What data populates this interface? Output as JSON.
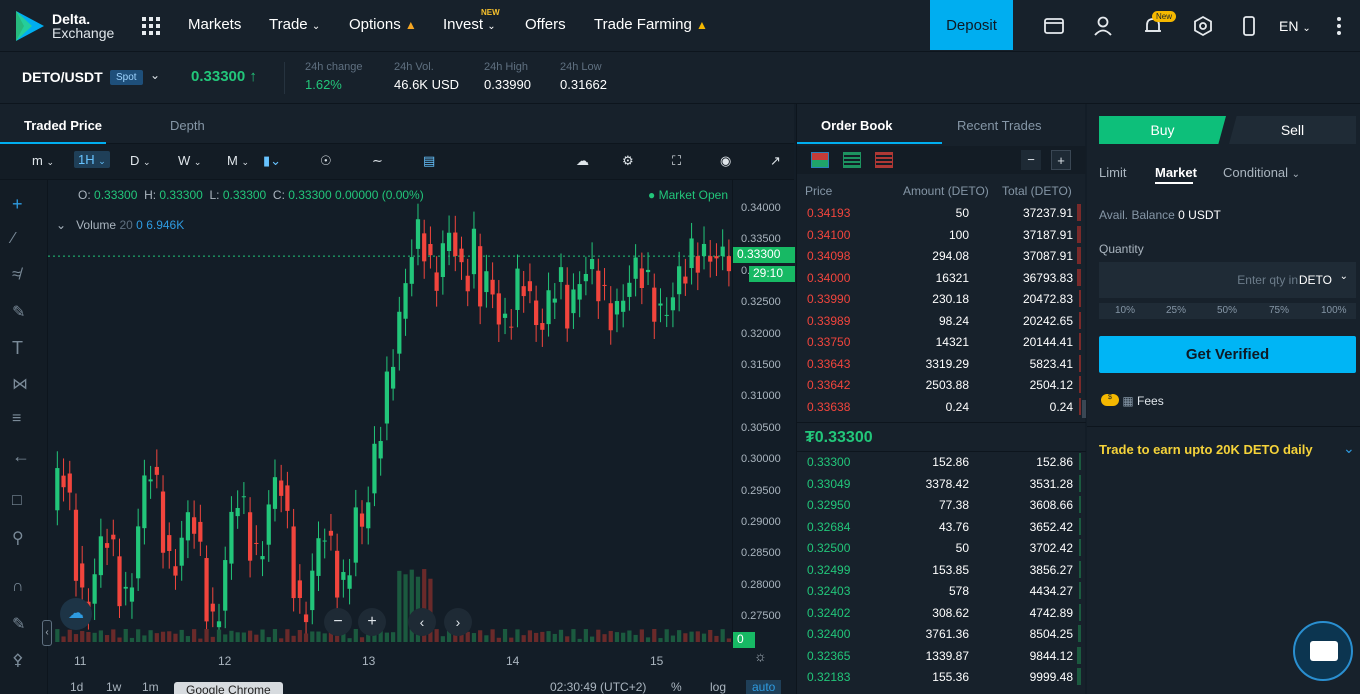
{
  "nav": {
    "logo_line1": "Delta.",
    "logo_line2": "Exchange",
    "markets": "Markets",
    "trade": "Trade",
    "options": "Options",
    "invest": "Invest",
    "invest_badge": "NEW",
    "offers": "Offers",
    "trade_farming": "Trade Farming",
    "deposit": "Deposit",
    "notif_badge": "New",
    "lang": "EN"
  },
  "ticker": {
    "pair": "DETO/USDT",
    "type": "Spot",
    "last_price": "0.33300",
    "change_label": "24h change",
    "change_value": "1.62%",
    "vol_label": "24h Vol.",
    "vol_value": "46.6K USD",
    "high_label": "24h High",
    "high_value": "0.33990",
    "low_label": "24h Low",
    "low_value": "0.31662"
  },
  "chart_panel": {
    "tab_traded": "Traded Price",
    "tab_depth": "Depth",
    "tool_m": "m",
    "tool_1h": "1H",
    "tool_d": "D",
    "tool_w": "W",
    "tool_mo": "M",
    "ohlc_o_label": "O:",
    "ohlc_o": "0.33300",
    "ohlc_h_label": "H:",
    "ohlc_h": "0.33300",
    "ohlc_l_label": "L:",
    "ohlc_l": "0.33300",
    "ohlc_c_label": "C:",
    "ohlc_c": "0.33300",
    "ohlc_chg": "0.00000 (0.00%)",
    "market_status": "Market Open",
    "volume_label": "Volume",
    "volume_period": "20",
    "volume_zero": "0",
    "volume_value": "6.946K",
    "price_tag": "0.33300",
    "countdown": "29:10",
    "vol_tag": "0",
    "y_ticks": [
      "0.34000",
      "0.33500",
      "0.33000",
      "0.32500",
      "0.32000",
      "0.31500",
      "0.31000",
      "0.30500",
      "0.30000",
      "0.29500",
      "0.29000",
      "0.28500",
      "0.28000",
      "0.27500"
    ],
    "x_ticks": [
      "11",
      "12",
      "13",
      "14",
      "15"
    ],
    "range_1d": "1d",
    "range_1w": "1w",
    "range_1m": "1m",
    "tooltip": "Google Chrome",
    "clock": "02:30:49 (UTC+2)",
    "pct": "%",
    "log": "log",
    "auto": "auto"
  },
  "orderbook": {
    "tab_book": "Order Book",
    "tab_trades": "Recent Trades",
    "col_price": "Price",
    "col_amount": "Amount (DETO)",
    "col_total": "Total (DETO)",
    "mid_price": "₮0.33300",
    "asks": [
      {
        "p": "0.34193",
        "a": "50",
        "t": "37237.91"
      },
      {
        "p": "0.34100",
        "a": "100",
        "t": "37187.91"
      },
      {
        "p": "0.34098",
        "a": "294.08",
        "t": "37087.91"
      },
      {
        "p": "0.34000",
        "a": "16321",
        "t": "36793.83"
      },
      {
        "p": "0.33990",
        "a": "230.18",
        "t": "20472.83"
      },
      {
        "p": "0.33989",
        "a": "98.24",
        "t": "20242.65"
      },
      {
        "p": "0.33750",
        "a": "14321",
        "t": "20144.41"
      },
      {
        "p": "0.33643",
        "a": "3319.29",
        "t": "5823.41"
      },
      {
        "p": "0.33642",
        "a": "2503.88",
        "t": "2504.12"
      },
      {
        "p": "0.33638",
        "a": "0.24",
        "t": "0.24"
      }
    ],
    "bids": [
      {
        "p": "0.33300",
        "a": "152.86",
        "t": "152.86"
      },
      {
        "p": "0.33049",
        "a": "3378.42",
        "t": "3531.28"
      },
      {
        "p": "0.32950",
        "a": "77.38",
        "t": "3608.66"
      },
      {
        "p": "0.32684",
        "a": "43.76",
        "t": "3652.42"
      },
      {
        "p": "0.32500",
        "a": "50",
        "t": "3702.42"
      },
      {
        "p": "0.32499",
        "a": "153.85",
        "t": "3856.27"
      },
      {
        "p": "0.32403",
        "a": "578",
        "t": "4434.27"
      },
      {
        "p": "0.32402",
        "a": "308.62",
        "t": "4742.89"
      },
      {
        "p": "0.32400",
        "a": "3761.36",
        "t": "8504.25"
      },
      {
        "p": "0.32365",
        "a": "1339.87",
        "t": "9844.12"
      },
      {
        "p": "0.32183",
        "a": "155.36",
        "t": "9999.48"
      }
    ]
  },
  "trade_panel": {
    "buy": "Buy",
    "sell": "Sell",
    "limit": "Limit",
    "market": "Market",
    "conditional": "Conditional",
    "balance_label": "Avail. Balance",
    "balance_value": "0 USDT",
    "quantity_label": "Quantity",
    "qty_placeholder": "Enter qty in",
    "qty_unit": "DETO",
    "pcts": [
      "10%",
      "25%",
      "50%",
      "75%",
      "100%"
    ],
    "get_verified": "Get Verified",
    "fees": "Fees",
    "earn": "Trade to earn upto 20K DETO daily"
  },
  "colors": {
    "accent": "#00aef0",
    "up": "#22c67a",
    "down": "#f2453d",
    "bg": "#17212b"
  }
}
